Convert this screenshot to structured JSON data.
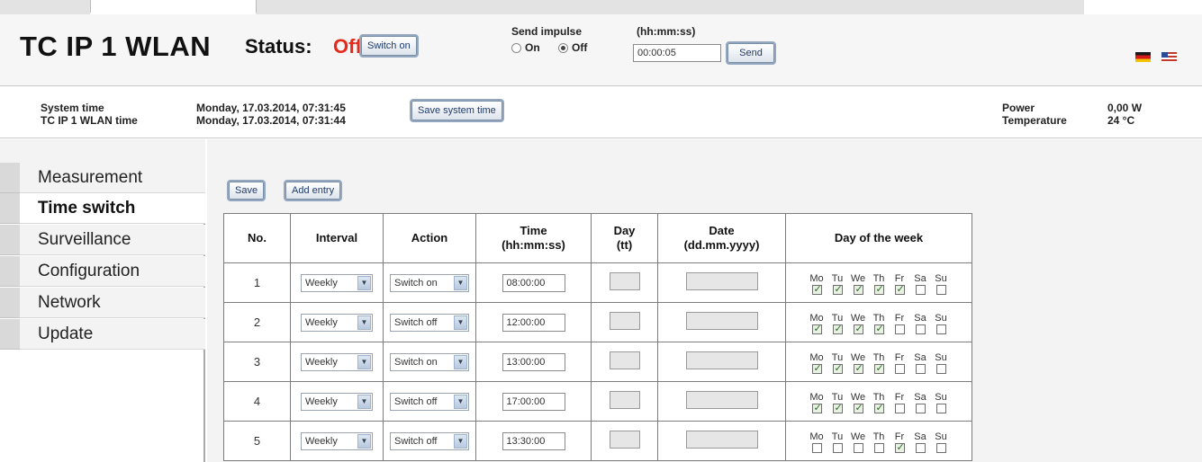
{
  "header": {
    "device_name": "TC IP 1 WLAN",
    "status_label": "Status:",
    "status_value": "Off",
    "status_color": "#e52a1c",
    "switch_button_label": "Switch on",
    "send_impulse_label": "Send impulse",
    "impulse_options": {
      "on": "On",
      "off": "Off",
      "selected": "Off"
    },
    "impulse_time_label": "(hh:mm:ss)",
    "impulse_time_value": "00:00:05",
    "send_button_label": "Send",
    "languages": [
      "german-flag-icon",
      "us-flag-icon"
    ]
  },
  "info": {
    "system_time_label": "System time",
    "system_time_value": "Monday, 17.03.2014, 07:31:45",
    "device_time_label": "TC IP 1 WLAN time",
    "device_time_value": "Monday, 17.03.2014, 07:31:44",
    "save_time_button_label": "Save system time",
    "power_label": "Power",
    "power_value": "0,00 W",
    "temperature_label": "Temperature",
    "temperature_value": "24 °C"
  },
  "sidebar": {
    "items": [
      {
        "label": "Measurement",
        "active": false
      },
      {
        "label": "Time switch",
        "active": true
      },
      {
        "label": "Surveillance",
        "active": false
      },
      {
        "label": "Configuration",
        "active": false
      },
      {
        "label": "Network",
        "active": false
      },
      {
        "label": "Update",
        "active": false
      }
    ]
  },
  "toolbar": {
    "save_label": "Save",
    "add_entry_label": "Add entry"
  },
  "table": {
    "headers": {
      "no": "No.",
      "interval": "Interval",
      "action": "Action",
      "time_line1": "Time",
      "time_line2": "(hh:mm:ss)",
      "day_line1": "Day",
      "day_line2": "(tt)",
      "date_line1": "Date",
      "date_line2": "(dd.mm.yyyy)",
      "dow": "Day of the week"
    },
    "weekday_labels": [
      "Mo",
      "Tu",
      "We",
      "Th",
      "Fr",
      "Sa",
      "Su"
    ],
    "rows": [
      {
        "no": "1",
        "interval": "Weekly",
        "action": "Switch on",
        "time": "08:00:00",
        "day": "",
        "date": "",
        "days": [
          true,
          true,
          true,
          true,
          true,
          false,
          false
        ]
      },
      {
        "no": "2",
        "interval": "Weekly",
        "action": "Switch off",
        "time": "12:00:00",
        "day": "",
        "date": "",
        "days": [
          true,
          true,
          true,
          true,
          false,
          false,
          false
        ]
      },
      {
        "no": "3",
        "interval": "Weekly",
        "action": "Switch on",
        "time": "13:00:00",
        "day": "",
        "date": "",
        "days": [
          true,
          true,
          true,
          true,
          false,
          false,
          false
        ]
      },
      {
        "no": "4",
        "interval": "Weekly",
        "action": "Switch off",
        "time": "17:00:00",
        "day": "",
        "date": "",
        "days": [
          true,
          true,
          true,
          true,
          false,
          false,
          false
        ]
      },
      {
        "no": "5",
        "interval": "Weekly",
        "action": "Switch off",
        "time": "13:30:00",
        "day": "",
        "date": "",
        "days": [
          false,
          false,
          false,
          false,
          true,
          false,
          false
        ]
      }
    ]
  }
}
